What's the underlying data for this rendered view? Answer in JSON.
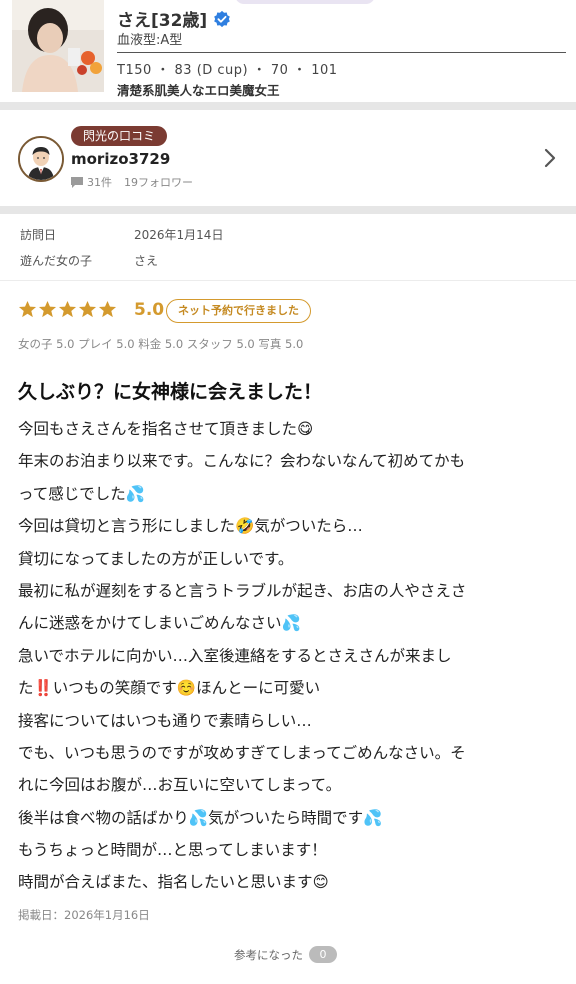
{
  "cast": {
    "name": "さえ[32歳]",
    "blood_type": "血液型:A型",
    "sizes": "T150 ・ 83 (D cup) ・ 70 ・ 101",
    "catchphrase": "清楚系肌美人なエロ美魔女王"
  },
  "reviewer": {
    "badge": "閃光の口コミ",
    "name": "morizo3729",
    "reviews": "31件",
    "followers": "19フォロワー"
  },
  "visit": {
    "date_label": "訪問日",
    "date_value": "2026年1月14日",
    "girl_label": "遊んだ女の子",
    "girl_value": "さえ"
  },
  "rating": {
    "stars": 5,
    "score": "5.0",
    "booking_badge": "ネット予約で行きました",
    "sub_scores": "女の子 5.0 プレイ 5.0 料金 5.0 スタッフ 5.0 写真 5.0"
  },
  "review": {
    "title": "久しぶり？に女神様に会えました！",
    "lines": [
      "今回もさえさんを指名させて頂きました😋",
      "年末のお泊まり以来です。こんなに？会わないなんて初めてかも",
      "って感じでした💦",
      "今回は貸切と言う形にしました🤣気がついたら…",
      "貸切になってましたの方が正しいです。",
      "最初に私が遅刻をすると言うトラブルが起き、お店の人やさえさ",
      "んに迷惑をかけてしまいごめんなさい💦",
      "急いでホテルに向かい…入室後連絡をするとさえさんが来まし",
      "た‼️いつもの笑顔です☺️ほんとーに可愛い",
      "接客についてはいつも通りで素晴らしい…",
      "でも、いつも思うのですが攻めすぎてしまってごめんなさい。そ",
      "れに今回はお腹が…お互いに空いてしまって。",
      "後半は食べ物の話ばかり💦気がついたら時間です💦",
      "もうちょっと時間が…と思ってしまいます！",
      "時間が合えばまた、指名したいと思います😊"
    ],
    "posted": "掲載日：2026年1月16日"
  },
  "helpful": {
    "label": "参考になった",
    "count": "0"
  },
  "colors": {
    "accent_gold": "#d49a2e",
    "badge_brown": "#7b3b32",
    "verified_blue": "#2f7fe0"
  }
}
